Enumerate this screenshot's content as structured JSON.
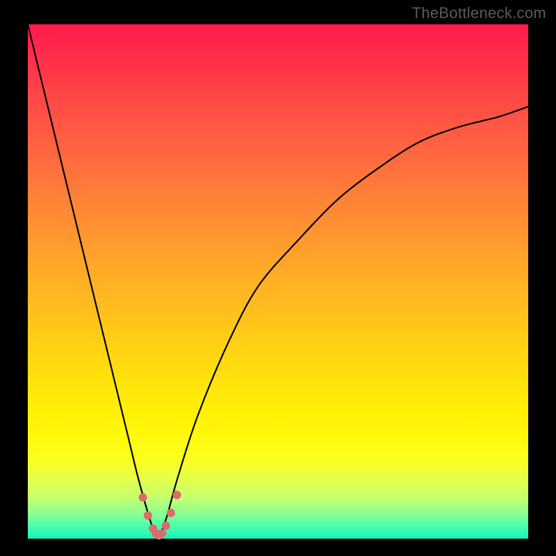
{
  "watermark": "TheBottleneck.com",
  "chart_data": {
    "type": "line",
    "title": "",
    "xlabel": "",
    "ylabel": "",
    "xlim": [
      0,
      100
    ],
    "ylim": [
      0,
      100
    ],
    "grid": false,
    "series": [
      {
        "name": "bottleneck-curve",
        "x": [
          0,
          4,
          8,
          12,
          16,
          20,
          22,
          24,
          25,
          25.5,
          26,
          26.5,
          27,
          28,
          30,
          34,
          40,
          46,
          54,
          62,
          70,
          78,
          86,
          94,
          100
        ],
        "values": [
          100,
          84,
          68,
          52,
          36,
          20,
          12,
          5,
          2,
          1,
          0.5,
          1,
          2,
          5,
          12,
          24,
          38,
          49,
          58,
          66,
          72,
          77,
          80,
          82,
          84
        ],
        "color": "#000000",
        "stroke_width": 2.2
      }
    ],
    "markers": {
      "name": "highlight-points",
      "color": "#de6a6a",
      "radius": 6,
      "points_x": [
        23.0,
        24.0,
        25.0,
        25.6,
        26.2,
        26.8,
        27.6,
        28.6,
        29.8
      ],
      "points_y": [
        8.0,
        4.5,
        2.0,
        1.0,
        0.6,
        1.0,
        2.5,
        5.0,
        8.5
      ]
    }
  }
}
